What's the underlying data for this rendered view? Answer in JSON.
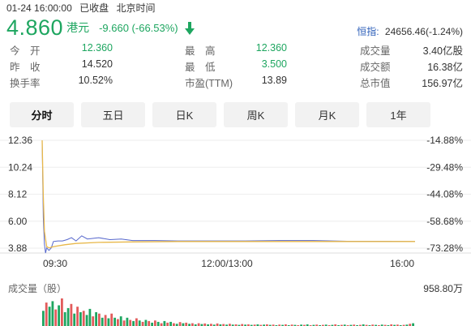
{
  "header": {
    "datetime": "01-24 16:00:00",
    "market_status": "已收盘",
    "timezone": "北京时间"
  },
  "quote": {
    "price": "4.860",
    "currency": "港元",
    "change": "-9.660 (-66.53%)",
    "trend_color": "#1ea660",
    "direction_icon": "arrow-down-icon"
  },
  "index": {
    "name": "恒指:",
    "value": "24656.46(-1.24%)"
  },
  "stats": [
    [
      {
        "label": "今　开",
        "value": "12.360",
        "color": "#1ea660"
      },
      {
        "label": "最　高",
        "value": "12.360",
        "color": "#1ea660"
      },
      {
        "label": "成交量",
        "value": "3.40亿股",
        "color": "#333333"
      }
    ],
    [
      {
        "label": "昨　收",
        "value": "14.520",
        "color": "#333333"
      },
      {
        "label": "最　低",
        "value": "3.500",
        "color": "#1ea660"
      },
      {
        "label": "成交额",
        "value": "16.38亿",
        "color": "#333333"
      }
    ],
    [
      {
        "label": "换手率",
        "value": "10.52%",
        "color": "#333333"
      },
      {
        "label": "市盈(TTM)",
        "value": "13.89",
        "color": "#333333"
      },
      {
        "label": "总市值",
        "value": "156.97亿",
        "color": "#333333"
      }
    ]
  ],
  "tabs": [
    {
      "label": "分时",
      "active": true
    },
    {
      "label": "五日",
      "active": false
    },
    {
      "label": "日K",
      "active": false
    },
    {
      "label": "周K",
      "active": false
    },
    {
      "label": "月K",
      "active": false
    },
    {
      "label": "1年",
      "active": false
    }
  ],
  "chart_data": {
    "type": "line",
    "prev_close": 14.52,
    "y_left_ticks": [
      "12.36",
      "10.24",
      "8.12",
      "6.00",
      "3.88"
    ],
    "y_right_ticks": [
      "-14.88%",
      "-29.48%",
      "-44.08%",
      "-58.68%",
      "-73.28%"
    ],
    "ylim": [
      3.88,
      12.36
    ],
    "x_labels": [
      "09:30",
      "12:00/13:00",
      "16:00"
    ],
    "series": [
      {
        "color": "#5566cc",
        "x": [
          0,
          1,
          2,
          3,
          4,
          6,
          8,
          10,
          14,
          18,
          22,
          26,
          30,
          35,
          40,
          50,
          60,
          70,
          80,
          90,
          100,
          120,
          150,
          180,
          210,
          240,
          270,
          300,
          330
        ],
        "values": [
          12.36,
          6.3,
          4.2,
          3.5,
          3.9,
          3.7,
          3.9,
          4.4,
          4.45,
          4.45,
          4.55,
          4.7,
          4.45,
          4.85,
          4.6,
          4.7,
          4.55,
          4.6,
          4.48,
          4.48,
          4.48,
          4.45,
          4.45,
          4.45,
          4.48,
          4.48,
          4.42,
          4.42,
          4.4
        ]
      },
      {
        "color": "#e8b84a",
        "x": [
          0,
          1,
          2,
          4,
          6,
          10,
          20,
          30,
          50,
          80,
          120,
          180,
          240,
          300,
          330
        ],
        "values": [
          12.36,
          8.0,
          5.2,
          4.0,
          3.9,
          4.0,
          4.15,
          4.25,
          4.33,
          4.37,
          4.4,
          4.4,
          4.4,
          4.4,
          4.4
        ]
      }
    ],
    "volume": {
      "title": "成交量（股）",
      "max_label": "958.80万",
      "up_color": "#e25b5b",
      "down_color": "#1ea660",
      "bars": [
        [
          0.55,
          "d"
        ],
        [
          0.85,
          "u"
        ],
        [
          0.7,
          "d"
        ],
        [
          0.9,
          "d"
        ],
        [
          0.6,
          "u"
        ],
        [
          0.75,
          "d"
        ],
        [
          1.0,
          "u"
        ],
        [
          0.5,
          "d"
        ],
        [
          0.65,
          "d"
        ],
        [
          0.8,
          "u"
        ],
        [
          0.45,
          "d"
        ],
        [
          0.7,
          "u"
        ],
        [
          0.5,
          "d"
        ],
        [
          0.55,
          "u"
        ],
        [
          0.4,
          "d"
        ],
        [
          0.62,
          "d"
        ],
        [
          0.35,
          "u"
        ],
        [
          0.5,
          "d"
        ],
        [
          0.45,
          "u"
        ],
        [
          0.3,
          "d"
        ],
        [
          0.4,
          "u"
        ],
        [
          0.28,
          "d"
        ],
        [
          0.45,
          "u"
        ],
        [
          0.3,
          "d"
        ],
        [
          0.25,
          "u"
        ],
        [
          0.35,
          "d"
        ],
        [
          0.2,
          "u"
        ],
        [
          0.3,
          "d"
        ],
        [
          0.22,
          "u"
        ],
        [
          0.18,
          "d"
        ],
        [
          0.28,
          "u"
        ],
        [
          0.2,
          "d"
        ],
        [
          0.15,
          "u"
        ],
        [
          0.22,
          "d"
        ],
        [
          0.18,
          "u"
        ],
        [
          0.12,
          "d"
        ],
        [
          0.2,
          "u"
        ],
        [
          0.15,
          "d"
        ],
        [
          0.1,
          "u"
        ],
        [
          0.18,
          "d"
        ],
        [
          0.12,
          "u"
        ],
        [
          0.15,
          "d"
        ],
        [
          0.1,
          "u"
        ],
        [
          0.08,
          "d"
        ],
        [
          0.14,
          "u"
        ],
        [
          0.1,
          "d"
        ],
        [
          0.12,
          "u"
        ],
        [
          0.08,
          "d"
        ],
        [
          0.1,
          "u"
        ],
        [
          0.06,
          "d"
        ],
        [
          0.1,
          "u"
        ],
        [
          0.07,
          "d"
        ],
        [
          0.09,
          "u"
        ],
        [
          0.06,
          "d"
        ],
        [
          0.08,
          "u"
        ],
        [
          0.05,
          "d"
        ],
        [
          0.09,
          "u"
        ],
        [
          0.06,
          "d"
        ],
        [
          0.07,
          "u"
        ],
        [
          0.05,
          "d"
        ],
        [
          0.08,
          "u"
        ],
        [
          0.05,
          "d"
        ],
        [
          0.06,
          "u"
        ],
        [
          0.04,
          "d"
        ],
        [
          0.07,
          "u"
        ],
        [
          0.05,
          "d"
        ],
        [
          0.06,
          "u"
        ],
        [
          0.04,
          "d"
        ],
        [
          0.05,
          "u"
        ],
        [
          0.06,
          "d"
        ],
        [
          0.04,
          "u"
        ],
        [
          0.05,
          "d"
        ],
        [
          0.06,
          "u"
        ],
        [
          0.04,
          "d"
        ],
        [
          0.05,
          "u"
        ],
        [
          0.03,
          "d"
        ],
        [
          0.05,
          "u"
        ],
        [
          0.04,
          "d"
        ],
        [
          0.06,
          "u"
        ],
        [
          0.03,
          "d"
        ],
        [
          0.05,
          "u"
        ],
        [
          0.04,
          "d"
        ],
        [
          0.03,
          "u"
        ],
        [
          0.05,
          "d"
        ],
        [
          0.04,
          "u"
        ],
        [
          0.06,
          "d"
        ],
        [
          0.03,
          "u"
        ],
        [
          0.04,
          "d"
        ],
        [
          0.05,
          "u"
        ],
        [
          0.03,
          "d"
        ],
        [
          0.04,
          "u"
        ],
        [
          0.05,
          "d"
        ],
        [
          0.03,
          "u"
        ],
        [
          0.04,
          "d"
        ],
        [
          0.06,
          "u"
        ],
        [
          0.03,
          "d"
        ],
        [
          0.04,
          "u"
        ],
        [
          0.05,
          "d"
        ],
        [
          0.03,
          "u"
        ],
        [
          0.04,
          "d"
        ],
        [
          0.05,
          "u"
        ],
        [
          0.03,
          "d"
        ],
        [
          0.04,
          "u"
        ],
        [
          0.06,
          "d"
        ],
        [
          0.04,
          "u"
        ],
        [
          0.03,
          "d"
        ],
        [
          0.05,
          "u"
        ],
        [
          0.04,
          "d"
        ],
        [
          0.03,
          "u"
        ],
        [
          0.05,
          "d"
        ],
        [
          0.04,
          "u"
        ],
        [
          0.03,
          "d"
        ],
        [
          0.06,
          "u"
        ],
        [
          0.04,
          "d"
        ],
        [
          0.05,
          "u"
        ],
        [
          0.03,
          "d"
        ],
        [
          0.04,
          "u"
        ],
        [
          0.05,
          "d"
        ],
        [
          0.08,
          "u"
        ],
        [
          0.1,
          "d"
        ]
      ]
    }
  }
}
